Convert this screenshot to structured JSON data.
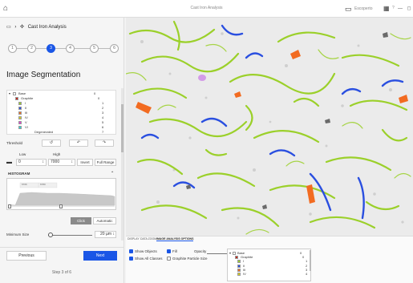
{
  "app": {
    "title": "Cast Iron Analysis",
    "user": "Escoperto",
    "help": "?"
  },
  "breadcrumb": {
    "title": "Cast Iron Analysis"
  },
  "steps": [
    "1",
    "2",
    "3",
    "4",
    "5",
    "6"
  ],
  "active_step": 3,
  "section": {
    "title": "Image Segmentation"
  },
  "classes": [
    {
      "name": "Base",
      "num": "0",
      "color": "#ffffff",
      "level": 0
    },
    {
      "name": "Graphite",
      "num": "0",
      "color": "#c0261a",
      "level": 1
    },
    {
      "name": "I",
      "num": "1",
      "color": "#9bd02a",
      "level": 2
    },
    {
      "name": "II",
      "num": "2",
      "color": "#2a4fe0",
      "level": 2
    },
    {
      "name": "III",
      "num": "3",
      "color": "#f26b21",
      "level": 2
    },
    {
      "name": "IV",
      "num": "4",
      "color": "#d7d11a",
      "level": 2
    },
    {
      "name": "V",
      "num": "5",
      "color": "#e63ad6",
      "level": 2
    },
    {
      "name": "VI",
      "num": "6",
      "color": "#2ad6d6",
      "level": 2
    },
    {
      "name": "Degenerated",
      "num": "7",
      "color": "",
      "level": 3
    }
  ],
  "threshold": {
    "label": "Threshold",
    "low_label": "Low",
    "high_label": "High",
    "low_value": "0",
    "high_value": "7000",
    "invert_label": "Invert",
    "full_range_label": "Full Range"
  },
  "histogram": {
    "title": "HISTOGRAM",
    "value_left": "6706",
    "value_right": "6780"
  },
  "click_label": "Click",
  "automatic_label": "Automatic",
  "minimum_size": {
    "label": "Minimum Size",
    "value": "20 µm",
    "level": 0.05
  },
  "nav": {
    "previous": "Previous",
    "next": "Next",
    "step_text": "Step 3 of 6"
  },
  "bottom_tabs": [
    "DISPLAY",
    "DATA ZOOM",
    "IMAGE ANALYSIS OPTIONS"
  ],
  "bottom_active_tab": 2,
  "options": {
    "show_objects": "Show Objects",
    "show_all_classes": "Show All Classes",
    "fill": "Fill",
    "graphite_particle_size": "Graphite Particle Size",
    "opacity": "Opacity",
    "opacity_level": 0.95
  },
  "legend2": [
    {
      "name": "Base",
      "num": "0",
      "color": "#ffffff",
      "level": 0
    },
    {
      "name": "Graphite",
      "num": "0",
      "color": "#c0261a",
      "level": 1
    },
    {
      "name": "I",
      "num": "1",
      "color": "#9bd02a",
      "level": 2
    },
    {
      "name": "II",
      "num": "2",
      "color": "#2a4fe0",
      "level": 2
    },
    {
      "name": "III",
      "num": "3",
      "color": "#f26b21",
      "level": 2
    },
    {
      "name": "IV",
      "num": "4",
      "color": "#d7d11a",
      "level": 2
    }
  ]
}
